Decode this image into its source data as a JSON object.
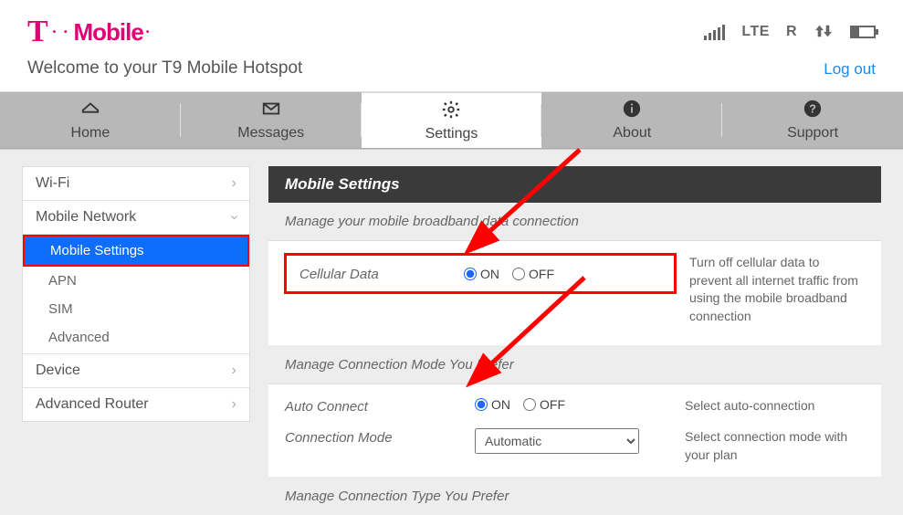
{
  "brand": {
    "text": "Mobile"
  },
  "status_bar": {
    "lte": "LTE",
    "roaming": "R"
  },
  "welcome": "Welcome to your T9 Mobile Hotspot",
  "logout": "Log out",
  "tabs": {
    "home": "Home",
    "messages": "Messages",
    "settings": "Settings",
    "about": "About",
    "support": "Support"
  },
  "sidebar": {
    "wifi": "Wi-Fi",
    "mobile_network": "Mobile Network",
    "mobile_settings": "Mobile Settings",
    "apn": "APN",
    "sim": "SIM",
    "advanced": "Advanced",
    "device": "Device",
    "advanced_router": "Advanced Router"
  },
  "panel": {
    "title": "Mobile Settings",
    "section1": "Manage your mobile broadband data connection",
    "cellular_label": "Cellular Data",
    "on": "ON",
    "off": "OFF",
    "cellular_help": "Turn off cellular data to prevent all internet traffic from using the mobile broadband connection",
    "section2": "Manage Connection Mode You Prefer",
    "auto_connect_label": "Auto Connect",
    "auto_connect_help": "Select auto-connection",
    "conn_mode_label": "Connection Mode",
    "conn_mode_value": "Automatic",
    "conn_mode_help": "Select connection mode with your plan",
    "section3": "Manage Connection Type You Prefer"
  }
}
